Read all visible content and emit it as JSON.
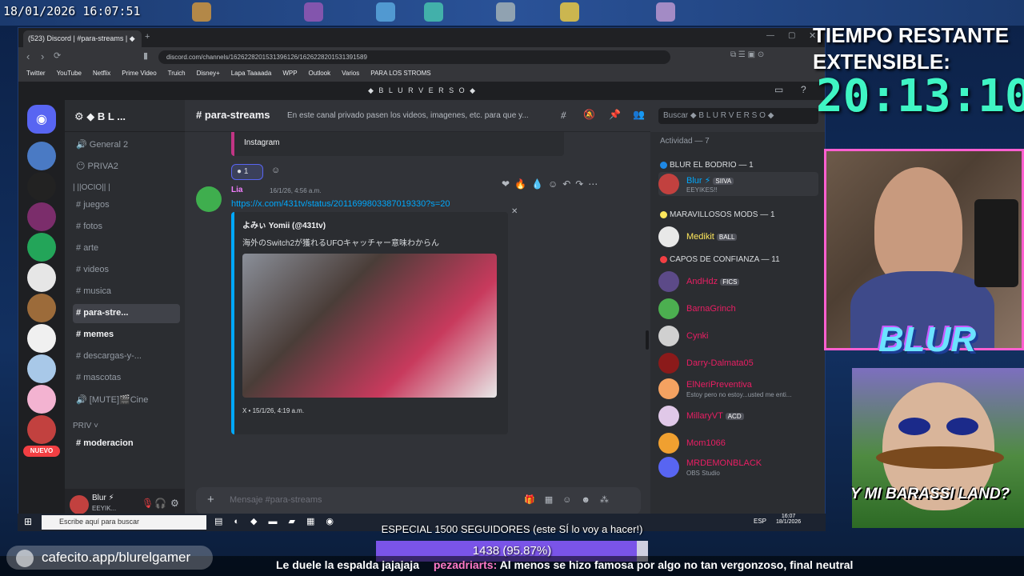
{
  "overlay": {
    "timestamp": "18/01/2026 16:07:51",
    "timer_label": "TIEMPO RESTANTE EXTENSIBLE:",
    "timer_value": "20:13:10",
    "streamer_logo": "BLUR",
    "meme_text": "Y MI BARASSI LAND?",
    "goal_title": "ESPECIAL 1500 SEGUIDORES (este SÍ lo voy a hacer!)",
    "goal_progress": "1438 (95.87%)",
    "goal_fraction": 0.9587,
    "kofi_url": "cafecito.app/blurelgamer",
    "ticker": "Le duele la espalda jajajaja",
    "ticker_user": "pezadriarts:",
    "ticker_msg": "Al menos se hizo famosa por algo no tan vergonzoso, final neutral"
  },
  "browser": {
    "tab_title": "(523) Discord | #para-streams | ◆",
    "url": "discord.com/channels/1626228201531396126/1626228201531391589",
    "bookmarks": [
      "Twitter",
      "YouTube",
      "Netflix",
      "Prime Video",
      "Truich",
      "Disney+",
      "Lapa Taaaada",
      "WPP",
      "Outlook",
      "Varios",
      "PARA LOS STROMS"
    ]
  },
  "discord": {
    "server_title": "◆ B L U R V E R S O ◆",
    "server_name": "◆ B L ...",
    "channel_name": "para-streams",
    "channel_topic": "En este canal privado pasen los videos, imagenes, etc. para que y...",
    "search_placeholder": "Buscar ◆ B L U R V E R S O ◆",
    "channels": {
      "general2": "General 2",
      "priva2": "PRIVA2",
      "ocio_cat": "| ||OCIO|| |",
      "juegos": "juegos",
      "fotos": "fotos",
      "arte": "arte",
      "videos": "videos",
      "musica": "musica",
      "para_streams": "para-stre...",
      "memes": "memes",
      "descargas": "descargas-y-...",
      "mascotas": "mascotas",
      "cine": "[MUTE]🎬Cine",
      "priv_cat": "PRIV",
      "moderacion": "moderacion"
    },
    "nuevo_badge": "NUEVO",
    "user": {
      "name": "Blur ⚡",
      "status": "EEYIK..."
    },
    "message": {
      "instagram_label": "Instagram",
      "reaction_count": "1",
      "author": "Lia",
      "timestamp": "16/1/26, 4:56 a.m.",
      "link": "https://x.com/431tv/status/2011699803387019330?s=20",
      "embed_author": "よみぃ Yomii (@431tv)",
      "embed_text": "海外のSwitch2が獲れるUFOキャッチャー意味わからん",
      "embed_footer": "X • 15/1/26, 4:19 a.m."
    },
    "input_placeholder": "Mensaje #para-streams",
    "members": {
      "activity": "Actividad — 7",
      "role1": "BLUR EL BODRIO",
      "role1_count": "— 1",
      "m1_name": "Blur ⚡",
      "m1_tag": "SIIVA",
      "m1_status": "EEYIKES!!",
      "role2": "MARAVILLOSOS MODS",
      "role2_count": "— 1",
      "m2_name": "Medikit",
      "m2_tag": "BALL",
      "role3": "CAPOS DE CONFIANZA",
      "role3_count": "— 11",
      "m3_name": "AndHdz",
      "m3_tag": "FICS",
      "m4_name": "BarnaGrinch",
      "m5_name": "Cynki",
      "m6_name": "Darry-Dalmata05",
      "m7_name": "ElNeriPreventiva",
      "m7_status": "Estoy pero no estoy...usted me enti...",
      "m8_name": "MillaryVT",
      "m8_tag": "ACD",
      "m9_name": "Mom1066",
      "m10_name": "MRDEMONBLACK",
      "m10_status": "OBS Studio"
    }
  },
  "taskbar": {
    "search": "Escribe aquí para buscar",
    "time": "16:07",
    "date": "18/1/2026",
    "lang": "ESP"
  },
  "colors": {
    "accent": "#3ff5c4",
    "goal": "#7a54e8",
    "mention_link": "#00a8fc"
  }
}
